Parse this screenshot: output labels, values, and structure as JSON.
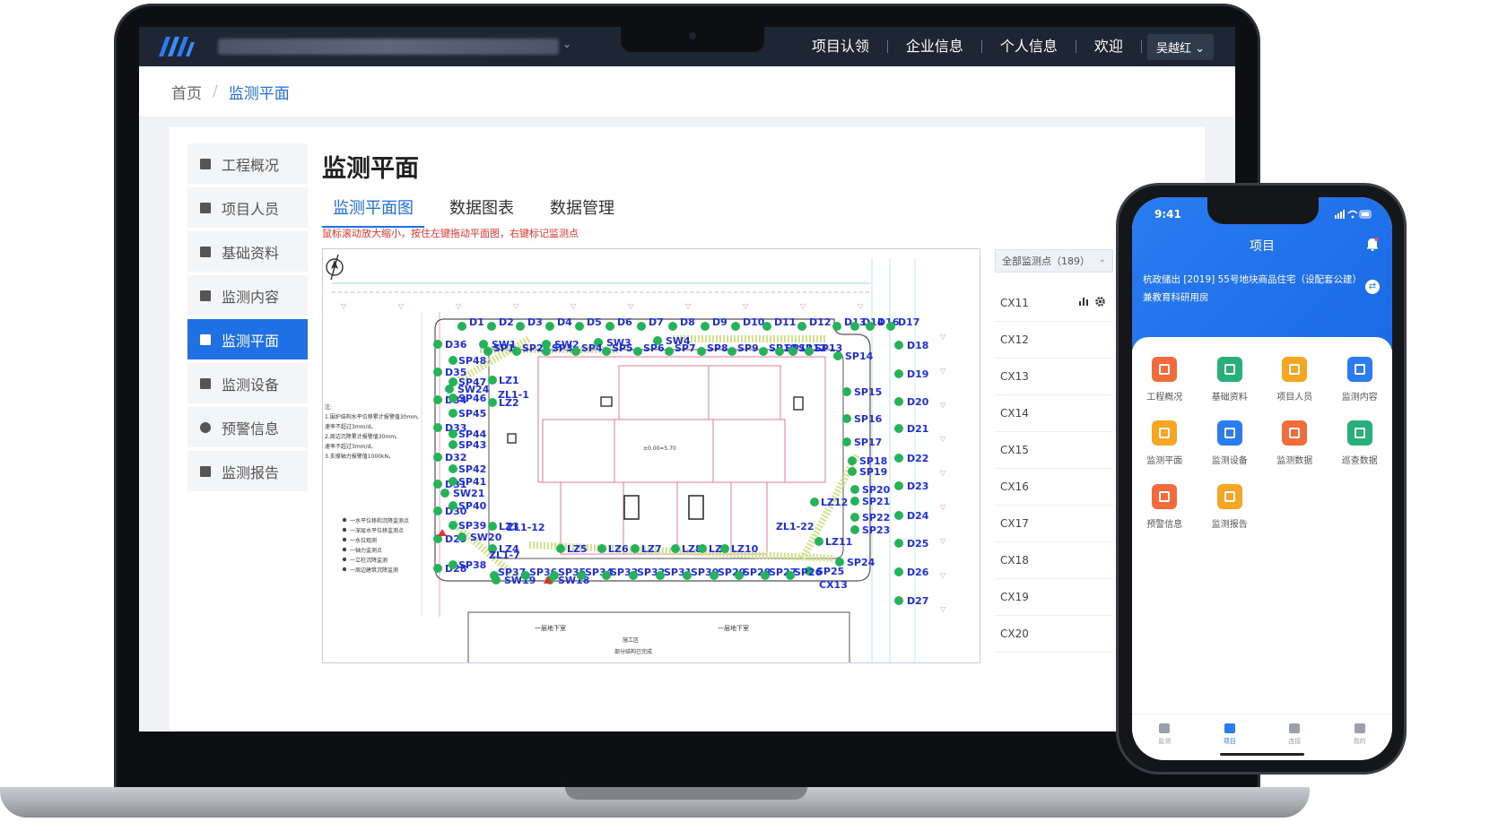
{
  "laptop": {
    "topbar": {
      "nav": [
        "项目认领",
        "企业信息",
        "个人信息",
        "欢迎"
      ],
      "user": "吴越红",
      "user_chevron": "⌄",
      "company_chevron": "⌄"
    },
    "breadcrumb": {
      "home": "首页",
      "separator": "/",
      "current": "监测平面"
    },
    "sidebar": {
      "items": [
        {
          "label": "工程概况",
          "icon": "document-icon"
        },
        {
          "label": "项目人员",
          "icon": "person-icon"
        },
        {
          "label": "基础资料",
          "icon": "folder-icon"
        },
        {
          "label": "监测内容",
          "icon": "list-icon"
        },
        {
          "label": "监测平面",
          "icon": "map-icon",
          "active": true
        },
        {
          "label": "监测设备",
          "icon": "device-icon"
        },
        {
          "label": "预警信息",
          "icon": "alarm-icon"
        },
        {
          "label": "监测报告",
          "icon": "report-icon"
        }
      ]
    },
    "main": {
      "title": "监测平面",
      "tabs": [
        "监测平面图",
        "数据图表",
        "数据管理"
      ],
      "active_tab": 0,
      "hint": "鼠标滚动放大缩小，按住左键拖动平面图，右键标记监测点"
    },
    "plan": {
      "marker_labels_top": [
        "D1",
        "D2",
        "D3",
        "D4",
        "D5",
        "D6",
        "D7",
        "D8",
        "D9",
        "D10",
        "D11",
        "D12",
        "D13",
        "D14",
        "D16",
        "D17"
      ],
      "marker_labels_right": [
        "D18",
        "D19",
        "D20",
        "D21",
        "D22",
        "D23",
        "D24",
        "D25",
        "D26",
        "D27"
      ],
      "marker_labels_sp_right": [
        "SP14",
        "SP15",
        "SP16",
        "SP17",
        "SP18",
        "SP19",
        "SP20",
        "SP21",
        "SP22",
        "SP23",
        "SP24",
        "SP25"
      ],
      "marker_labels_left": [
        "D36",
        "D35",
        "D34",
        "D33",
        "D32",
        "D31",
        "D30",
        "D29",
        "D28"
      ],
      "marker_labels_sp_left": [
        "SP48",
        "SP47",
        "SP46",
        "SP45",
        "SP44",
        "SP43",
        "SP42",
        "SP41",
        "SP40",
        "SP39",
        "SP38"
      ],
      "marker_labels_sw": [
        "SW1",
        "SW2",
        "SW3",
        "SW4",
        "SW24",
        "SW21",
        "SW20",
        "SW19",
        "SW18"
      ],
      "marker_labels_sp_top": [
        "SP1",
        "SP2",
        "SP3",
        "SP4",
        "SP5",
        "SP6",
        "SP7",
        "SP8",
        "SP9",
        "SP10",
        "SP11",
        "SP12",
        "SP13"
      ],
      "marker_labels_bottom": [
        "SP37",
        "SP36",
        "SP35",
        "SP34",
        "SP33",
        "SP32",
        "SP31",
        "SP30",
        "SP29",
        "SP28",
        "SP27",
        "SP26"
      ],
      "marker_labels_lz": [
        "LZ1",
        "LZ2",
        "LZ3",
        "LZ4",
        "LZ5",
        "LZ6",
        "LZ7",
        "LZ8",
        "LZ9",
        "LZ10",
        "LZ11",
        "LZ12"
      ],
      "extra_labels": [
        "ZL1-1",
        "ZL1-12",
        "ZL1-7",
        "ZL1-22",
        "CX13"
      ],
      "legend_lines": [
        "一水平位移和沉降监测点",
        "一深层水平位移监测点",
        "一水位观测",
        "一轴力监测点",
        "一立柱沉降监测",
        "一周边建筑沉降监测"
      ],
      "notes": [
        "注:",
        "1.围护结构水平位移累计报警值30mm,",
        "速率不超过3mm/d。",
        "2.周边沉降累计报警值30mm,",
        "速率不超过3mm/d。",
        "3.支撑轴力报警值1000kN。"
      ],
      "bottom_labels": [
        "一层地下室",
        "一层地下室",
        "施工区",
        "部分结构已完成"
      ],
      "center_label": "±0.00=5.70"
    },
    "points": {
      "select_label": "全部监测点（189）",
      "items": [
        "CX11",
        "CX12",
        "CX13",
        "CX14",
        "CX15",
        "CX16",
        "CX17",
        "CX18",
        "CX19",
        "CX20"
      ]
    }
  },
  "phone": {
    "time": "9:41",
    "title": "项目",
    "project_name": "杭政储出 [2019] 55号地块商品住宅（设配套公建）兼教育科研用房",
    "functions": [
      {
        "label": "工程概况",
        "color": "#f26b3a"
      },
      {
        "label": "基础资料",
        "color": "#27b07a"
      },
      {
        "label": "项目人员",
        "color": "#f5a623"
      },
      {
        "label": "监测内容",
        "color": "#2a7cf0"
      },
      {
        "label": "监测平面",
        "color": "#f5a623"
      },
      {
        "label": "监测设备",
        "color": "#2a7cf0"
      },
      {
        "label": "监测数据",
        "color": "#f26b3a"
      },
      {
        "label": "巡查数据",
        "color": "#27b07a"
      },
      {
        "label": "预警信息",
        "color": "#f26b3a"
      },
      {
        "label": "监测报告",
        "color": "#f5a623"
      }
    ],
    "tabbar": [
      {
        "label": "监测",
        "active": false
      },
      {
        "label": "项目",
        "active": true
      },
      {
        "label": "连接",
        "active": false
      },
      {
        "label": "我的",
        "active": false
      }
    ]
  },
  "colors": {
    "accent": "#1f6fe5",
    "marker_green": "#25b35a",
    "marker_label": "#1f2fe0",
    "topbar": "#1e2633",
    "hint": "#e5322d"
  }
}
